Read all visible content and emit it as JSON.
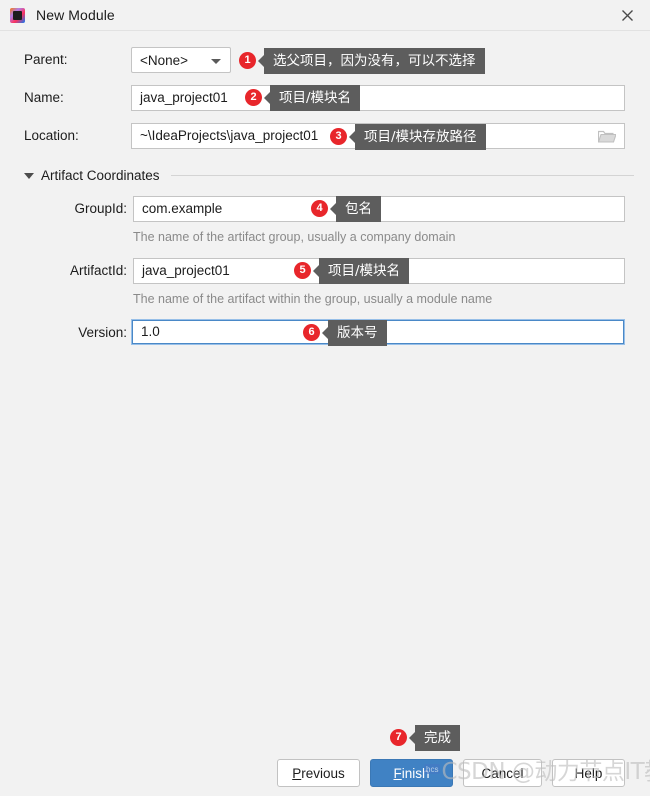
{
  "window": {
    "title": "New Module",
    "app_icon": "intellij-idea-icon",
    "close_icon": "close-icon"
  },
  "form": {
    "parent": {
      "label": "Parent:",
      "value": "<None>",
      "caret_icon": "chevron-down-icon"
    },
    "name": {
      "label": "Name:",
      "value": "java_project01"
    },
    "location": {
      "label": "Location:",
      "value": "~\\IdeaProjects\\java_project01",
      "browse_icon": "folder-browse-icon"
    },
    "section": {
      "label": "Artifact Coordinates",
      "toggle_icon": "triangle-down-icon"
    },
    "group_id": {
      "label": "GroupId:",
      "value": "com.example",
      "hint": "The name of the artifact group, usually a company domain"
    },
    "artifact_id": {
      "label": "ArtifactId:",
      "value": "java_project01",
      "hint": "The name of the artifact within the group, usually a module name"
    },
    "version": {
      "label": "Version:",
      "value": "1.0"
    }
  },
  "annotations": [
    {
      "number": "1",
      "text": "选父项目，因为没有，可以不选择"
    },
    {
      "number": "2",
      "text": "项目/模块名"
    },
    {
      "number": "3",
      "text": "项目/模块存放路径"
    },
    {
      "number": "4",
      "text": "包名"
    },
    {
      "number": "5",
      "text": "项目/模块名"
    },
    {
      "number": "6",
      "text": "版本号"
    },
    {
      "number": "7",
      "text": "完成"
    }
  ],
  "buttons": {
    "previous": {
      "mnemonic": "P",
      "rest": "revious"
    },
    "finish": {
      "mnemonic": "F",
      "rest": "inish"
    },
    "cancel": {
      "label": "Cancel"
    },
    "help": {
      "label": "Help"
    }
  },
  "watermark": {
    "logo": "hcs",
    "text": "CSDN @动力节点IT教育"
  },
  "colors": {
    "accent": "#4082c4",
    "badge": "#e8262b",
    "callout": "#5d5d5d",
    "dialog_bg": "#f2f2f2"
  }
}
